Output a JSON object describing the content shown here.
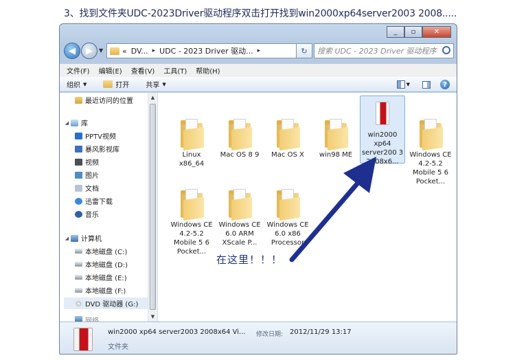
{
  "caption": "3、找到文件夹UDC-2023Driver驱动程序双击打开找到win2000xp64server2003 2008.....",
  "window": {
    "min_label": "_",
    "max_label": "▫",
    "close_label": "✕"
  },
  "address": {
    "segments": [
      "«",
      "DV...",
      "▸",
      "UDC - 2023 Driver 驱动...",
      "▸"
    ],
    "refresh_label": "↻",
    "search_placeholder": "搜索 UDC - 2023 Driver 驱动程序"
  },
  "menu": [
    "文件(F)",
    "编辑(E)",
    "查看(V)",
    "工具(T)",
    "帮助(H)"
  ],
  "toolbar": {
    "organize": "组织",
    "open": "打开",
    "share": "共享"
  },
  "nav": {
    "recent": "最近访问的位置",
    "libraries": "库",
    "library_items": [
      "PPTV视频",
      "暴风影视库",
      "视频",
      "图片",
      "文档",
      "迅雷下载",
      "音乐"
    ],
    "computer": "计算机",
    "drives": [
      "本地磁盘 (C:)",
      "本地磁盘 (D:)",
      "本地磁盘 (E:)",
      "本地磁盘 (F:)"
    ],
    "dvd": "DVD 驱动器 (G:)",
    "network_partial": "网络"
  },
  "files": [
    {
      "name": "Linux x86_64"
    },
    {
      "name": "Mac OS 8 9"
    },
    {
      "name": "Mac OS X"
    },
    {
      "name": "win98 ME"
    },
    {
      "name": "win2000 xp64 server200 3 2008x6..."
    },
    {
      "name": "Windows CE 4.2-5.2 Mobile 5 6 Pocket..."
    },
    {
      "name": "Windows CE 4.2-5.2 Mobile 5 6 Pocket..."
    },
    {
      "name": "Windows CE 6.0 ARM XScale P..."
    },
    {
      "name": "Windows CE 6.0 x86 Processor"
    }
  ],
  "annotation": "在这里！！！",
  "details": {
    "name": "win2000 xp64 server2003 2008x64 Vi...",
    "modified_label": "修改日期:",
    "modified_value": "2012/11/29 13:17",
    "type": "文件夹"
  },
  "colors": {
    "arrow": "#1f2f8f",
    "selection": "#dbe9f9"
  }
}
